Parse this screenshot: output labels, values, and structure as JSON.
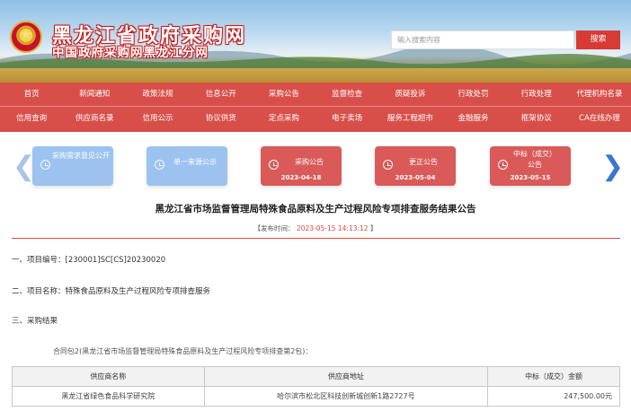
{
  "header": {
    "site_title": "黑龙江省政府采购网",
    "site_subtitle": "中国政府采购网黑龙江分网",
    "search_placeholder": "输入搜索内容",
    "search_button": "搜索"
  },
  "nav": {
    "row1": [
      "首页",
      "新闻通知",
      "政策法规",
      "信息公开",
      "采购公告",
      "监督检查",
      "质疑投诉",
      "行政处罚",
      "行政处理",
      "代理机构名录"
    ],
    "row2": [
      "信用查询",
      "供应商名录",
      "信用公示",
      "协议供货",
      "定点采购",
      "电子卖场",
      "服务工程超市",
      "金融服务",
      "框架协议",
      "CA在线办理"
    ]
  },
  "cards": [
    {
      "label": "采购需求意见公开",
      "date": "",
      "style": "blue",
      "icon": "minus-circle-icon"
    },
    {
      "label": "单一来源公示",
      "date": "",
      "style": "blue",
      "icon": "minus-circle-icon"
    },
    {
      "label": "采购公告",
      "date": "2023-04-18",
      "style": "red",
      "icon": "clock-icon"
    },
    {
      "label": "更正公告",
      "date": "2023-05-04",
      "style": "red",
      "icon": "clock-icon"
    },
    {
      "label": "中标（成交）公告",
      "date": "2023-05-15",
      "style": "red",
      "icon": "clock-icon"
    }
  ],
  "article": {
    "title": "黑龙江省市场监督管理局特殊食品原料及生产过程风险专项排查服务结果公告",
    "publish_prefix": "【发布时间：",
    "publish_time": "2023-05-15 14:13:12",
    "publish_suffix": "】",
    "section1": "一、项目编号：[230001]SC[CS]20230020",
    "section2": "二、项目名称：特殊食品原料及生产过程风险专项排查服务",
    "section3": "三、采购结果",
    "package": "合同包2(黑龙江省市场监督管理局特殊食品原料及生产过程风险专项排查第2包)："
  },
  "table": {
    "headers": [
      "供应商名称",
      "供应商地址",
      "中标（成交）金额"
    ],
    "rows": [
      [
        "黑龙江省绿色食品科学研究院",
        "哈尔滨市松北区科技创新城创新1路2727号",
        "247,500.00元"
      ]
    ]
  },
  "colors": {
    "nav_red": "#d84f4a",
    "accent_red": "#d94a44",
    "card_blue": "#9cc3ef"
  }
}
